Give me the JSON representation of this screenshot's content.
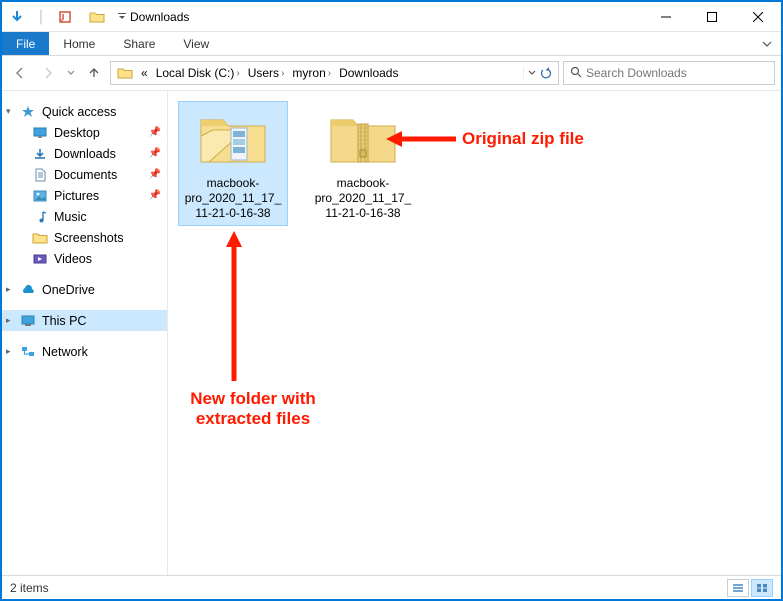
{
  "window": {
    "title": "Downloads"
  },
  "ribbon": {
    "file": "File",
    "tabs": [
      "Home",
      "Share",
      "View"
    ]
  },
  "breadcrumb": {
    "overflow": "«",
    "segments": [
      "Local Disk (C:)",
      "Users",
      "myron",
      "Downloads"
    ]
  },
  "search": {
    "placeholder": "Search Downloads"
  },
  "sidebar": {
    "quick_access": {
      "label": "Quick access"
    },
    "quick_items": [
      {
        "label": "Desktop",
        "icon": "desktop",
        "pinned": true
      },
      {
        "label": "Downloads",
        "icon": "downloads",
        "pinned": true
      },
      {
        "label": "Documents",
        "icon": "documents",
        "pinned": true
      },
      {
        "label": "Pictures",
        "icon": "pictures",
        "pinned": true
      },
      {
        "label": "Music",
        "icon": "music",
        "pinned": false
      },
      {
        "label": "Screenshots",
        "icon": "folder",
        "pinned": false
      },
      {
        "label": "Videos",
        "icon": "videos",
        "pinned": false
      }
    ],
    "onedrive": {
      "label": "OneDrive"
    },
    "thispc": {
      "label": "This PC"
    },
    "network": {
      "label": "Network"
    }
  },
  "files": [
    {
      "name": "macbook-pro_2020_11_17_11-21-0-16-38",
      "type": "folder",
      "selected": true
    },
    {
      "name": "macbook-pro_2020_11_17_11-21-0-16-38",
      "type": "zip",
      "selected": false
    }
  ],
  "status": {
    "count": "2 items"
  },
  "annotations": {
    "right_label": "Original zip file",
    "bottom_label": "New folder with\nextracted files"
  }
}
